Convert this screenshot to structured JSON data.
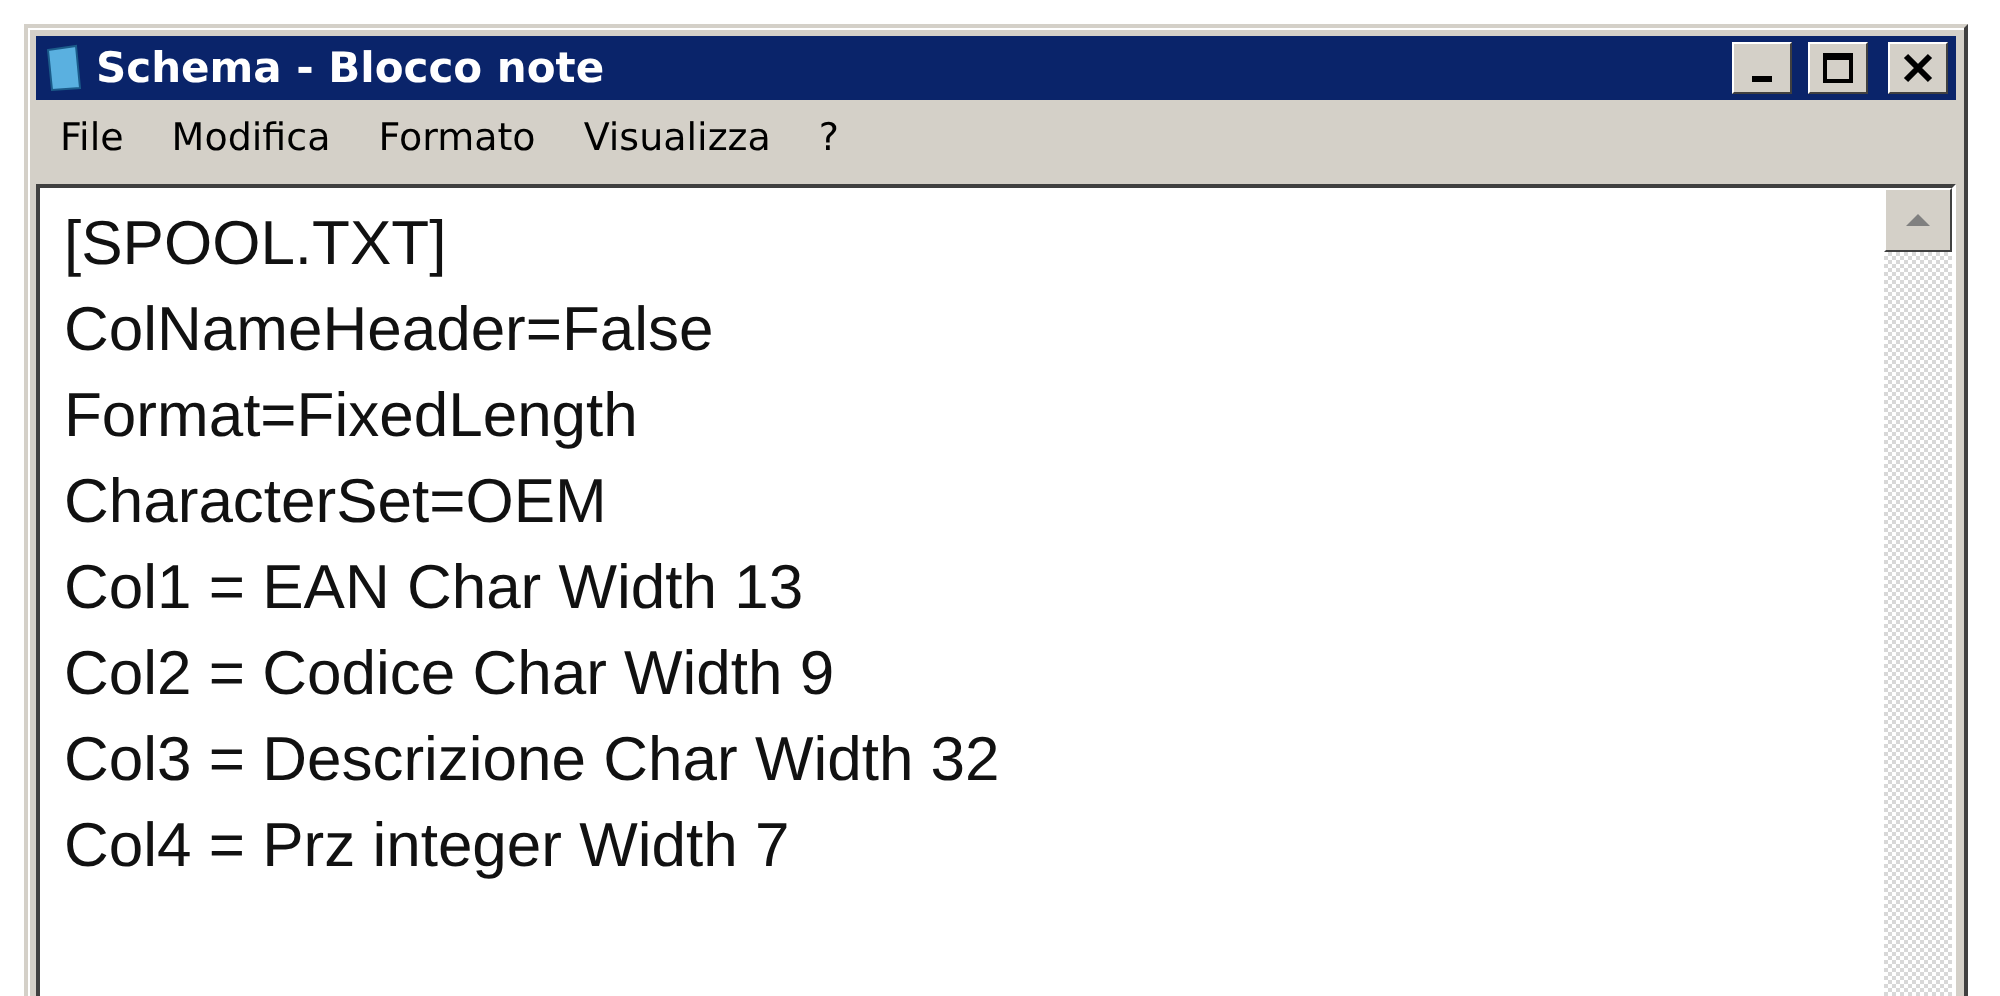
{
  "window": {
    "title": "Schema - Blocco note"
  },
  "menu": [
    "File",
    "Modifica",
    "Formato",
    "Visualizza",
    "?"
  ],
  "editor": {
    "lines": [
      "[SPOOL.TXT]",
      "ColNameHeader=False",
      "Format=FixedLength",
      "CharacterSet=OEM",
      "Col1 = EAN Char Width 13",
      "Col2 = Codice Char Width 9",
      "Col3 = Descrizione Char Width 32",
      "Col4 = Prz integer Width 7"
    ]
  }
}
